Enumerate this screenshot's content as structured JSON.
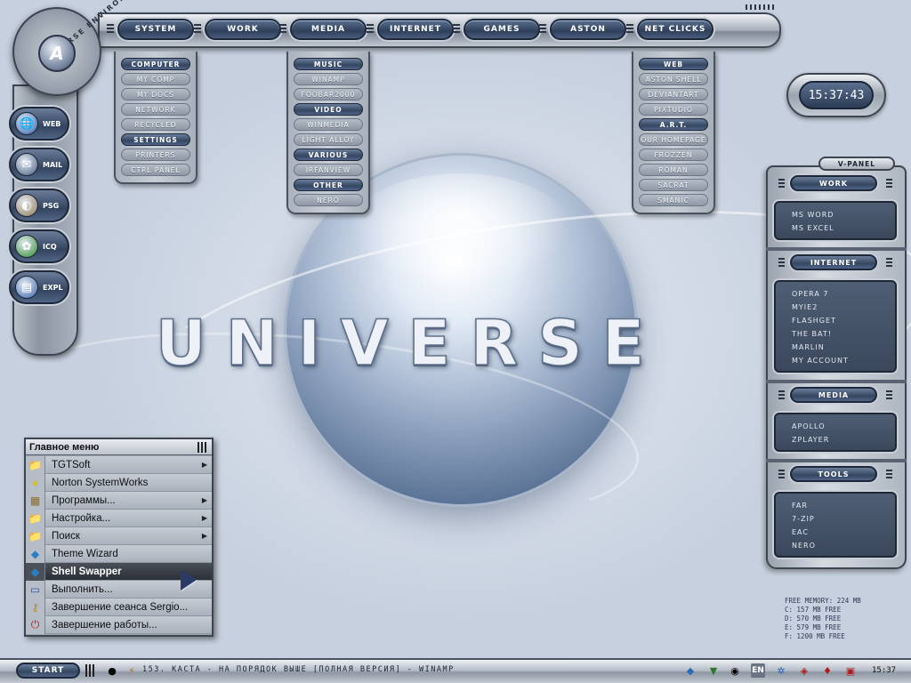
{
  "wallpaper": {
    "title": "UNIVERSE"
  },
  "logo": {
    "ring_text": "UNIVERSE ENVIRONMENT"
  },
  "top_nav": [
    "SYSTEM",
    "WORK",
    "MEDIA",
    "INTERNET",
    "GAMES",
    "ASTON",
    "NET CLICKS"
  ],
  "menus": {
    "system": [
      {
        "label": "COMPUTER",
        "head": true
      },
      {
        "label": "MY COMP"
      },
      {
        "label": "MY DOCS"
      },
      {
        "label": "NETWORK"
      },
      {
        "label": "RECYCLED"
      },
      {
        "label": "SETTINGS",
        "head": true
      },
      {
        "label": "PRINTERS"
      },
      {
        "label": "CTRL PANEL"
      }
    ],
    "media": [
      {
        "label": "MUSIC",
        "head": true
      },
      {
        "label": "WINAMP"
      },
      {
        "label": "FOOBAR2000"
      },
      {
        "label": "VIDEO",
        "head": true
      },
      {
        "label": "WINMEDIA"
      },
      {
        "label": "LIGHT ALLOY"
      },
      {
        "label": "VARIOUS",
        "head": true
      },
      {
        "label": "IRFANVIEW"
      },
      {
        "label": "OTHER",
        "head": true
      },
      {
        "label": "NERO"
      }
    ],
    "netclicks": [
      {
        "label": "WEB",
        "head": true
      },
      {
        "label": "ASTON SHELL"
      },
      {
        "label": "DEVIANTART"
      },
      {
        "label": "PIXTUDIO"
      },
      {
        "label": "A.R.T.",
        "head": true
      },
      {
        "label": "OUR HOMEPAGE"
      },
      {
        "label": "FROZZEN"
      },
      {
        "label": "ROMAN"
      },
      {
        "label": "SACRAT"
      },
      {
        "label": "SMANIC"
      }
    ]
  },
  "left_dock": [
    {
      "label": "WEB",
      "icon": "globe-icon"
    },
    {
      "label": "MAIL",
      "icon": "mail-icon"
    },
    {
      "label": "PSG",
      "icon": "disc-icon"
    },
    {
      "label": "ICQ",
      "icon": "flower-icon"
    },
    {
      "label": "EXPL",
      "icon": "explorer-icon"
    }
  ],
  "clock": {
    "time": "15:37:43"
  },
  "vpanel": {
    "title": "V-PANEL",
    "sections": [
      {
        "title": "WORK",
        "items": [
          "MS WORD",
          "MS EXCEL"
        ]
      },
      {
        "title": "INTERNET",
        "items": [
          "OPERA 7",
          "MYIE2",
          "FLASHGET",
          "THE BAT!",
          "MARLIN",
          "MY ACCOUNT"
        ]
      },
      {
        "title": "MEDIA",
        "items": [
          "APOLLO",
          "ZPLAYER"
        ]
      },
      {
        "title": "TOOLS",
        "items": [
          "FAR",
          "7-ZIP",
          "EAC",
          "NERO"
        ]
      }
    ]
  },
  "stats": {
    "memory": "FREE MEMORY: 224 MB",
    "c": "C: 157 MB FREE",
    "d": "D: 570 MB FREE",
    "e": "E: 579 MB FREE",
    "f": "F: 1200 MB FREE"
  },
  "start_menu": {
    "title": "Главное меню",
    "items": [
      {
        "label": "TGTSoft",
        "icon": "folder-icon",
        "submenu": true
      },
      {
        "label": "Norton SystemWorks",
        "icon": "norton-icon",
        "submenu": false
      },
      {
        "label": "Программы...",
        "icon": "programs-icon",
        "submenu": true
      },
      {
        "label": "Настройка...",
        "icon": "folder-icon",
        "submenu": true
      },
      {
        "label": "Поиск",
        "icon": "folder-icon",
        "submenu": true
      },
      {
        "label": "Theme Wizard",
        "icon": "diamond-icon",
        "submenu": false
      },
      {
        "label": "Shell Swapper",
        "icon": "diamond-icon",
        "submenu": false,
        "selected": true
      },
      {
        "label": "Выполнить...",
        "icon": "run-icon",
        "submenu": false
      },
      {
        "label": "Завершение сеанса Sergio...",
        "icon": "key-icon",
        "submenu": false
      },
      {
        "label": "Завершение работы...",
        "icon": "power-icon",
        "submenu": false
      }
    ]
  },
  "taskbar": {
    "start_label": "START",
    "now_playing": "153. КАСТА - НА ПОРЯДОК ВЫШЕ [ПОЛНАЯ ВЕРСИЯ] - WINAMP",
    "language": "EN",
    "time": "15:37"
  }
}
